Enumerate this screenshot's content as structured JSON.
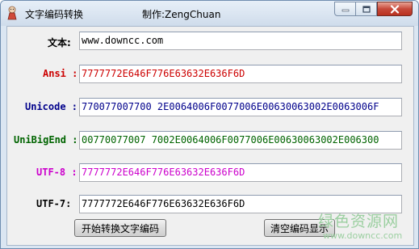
{
  "window": {
    "title": "文字编码转换",
    "author": "制作:ZengChuan"
  },
  "colors": {
    "ansi": "#cc0000",
    "unicode": "#00008b",
    "unibigend": "#006400",
    "utf8": "#cc00cc",
    "utf7": "#000000"
  },
  "icons": {
    "app": "app-icon",
    "minimize": "minimize-icon",
    "maximize": "maximize-icon",
    "close": "close-icon"
  },
  "form": {
    "text": {
      "label": "文本:",
      "value": "www.downcc.com"
    },
    "ansi": {
      "label": "Ansi :",
      "value": "7777772E646F776E63632E636F6D"
    },
    "unicode": {
      "label": "Unicode :",
      "value": "770077007700 2E0064006F0077006E00630063002E0063006F"
    },
    "unibigend": {
      "label": "UniBigEnd :",
      "value": "00770077007 7002E0064006F0077006E00630063002E006300"
    },
    "utf8": {
      "label": "UTF-8 :",
      "value": "7777772E646F776E63632E636F6D"
    },
    "utf7": {
      "label": "UTF-7:",
      "value": "7777772E646F776E63632E636F6D"
    }
  },
  "buttons": {
    "convert": "开始转换文字编码",
    "clear": "清空编码显示"
  },
  "watermark": {
    "cn": "绿色资源网",
    "url": "www.downcc.com"
  }
}
